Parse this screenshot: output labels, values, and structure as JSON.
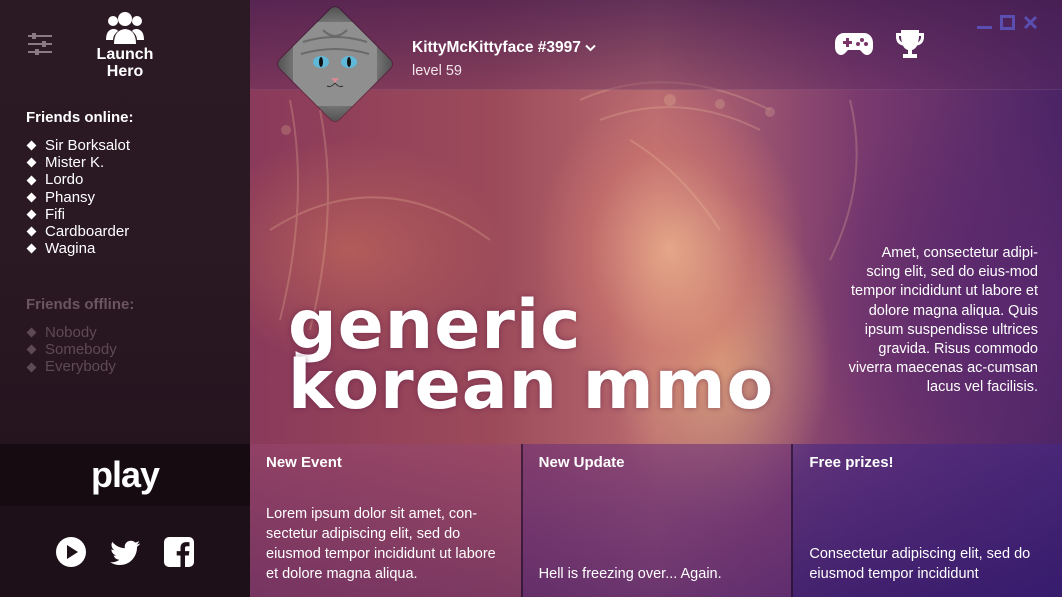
{
  "app": {
    "logo_text_1": "Launch",
    "logo_text_2": "Hero"
  },
  "sidebar": {
    "friends_online_title": "Friends online:",
    "friends_online": [
      "Sir Borksalot",
      "Mister K.",
      "Lordo",
      "Phansy",
      "Fifi",
      "Cardboarder",
      "Wagina"
    ],
    "friends_offline_title": "Friends offline:",
    "friends_offline": [
      "Nobody",
      "Somebody",
      "Everybody"
    ],
    "play_label": "play",
    "social_icons": [
      "play-circle-icon",
      "twitter-icon",
      "facebook-icon"
    ]
  },
  "header": {
    "username": "KittyMcKittyface #3997",
    "level": "level 59",
    "icons": [
      "gamepad-icon",
      "trophy-icon"
    ],
    "window_controls": [
      "minimize-icon",
      "maximize-icon",
      "close-icon"
    ]
  },
  "hero": {
    "title_line_1": "generic",
    "title_line_2": "korean mmo",
    "description": "Amet, consectetur adipi-scing elit, sed do eius-mod tempor incididunt ut labore et dolore magna aliqua. Quis ipsum suspendisse ultrices gravida. Risus commodo viverra maecenas ac-cumsan lacus vel facilisis."
  },
  "news": [
    {
      "title": "New Event",
      "body": "Lorem ipsum dolor sit amet, con-sectetur adipiscing elit, sed do eiusmod tempor incididunt ut labore et dolore magna aliqua."
    },
    {
      "title": "New Update",
      "body": "Hell is freezing over... Again."
    },
    {
      "title": "Free prizes!",
      "body": "Consectetur adipiscing elit, sed do eiusmod tempor incididunt"
    }
  ],
  "colors": {
    "sidebar_bg": "#2a1822",
    "offline_text": "#5e4a55",
    "play_bg": "#150b11"
  }
}
